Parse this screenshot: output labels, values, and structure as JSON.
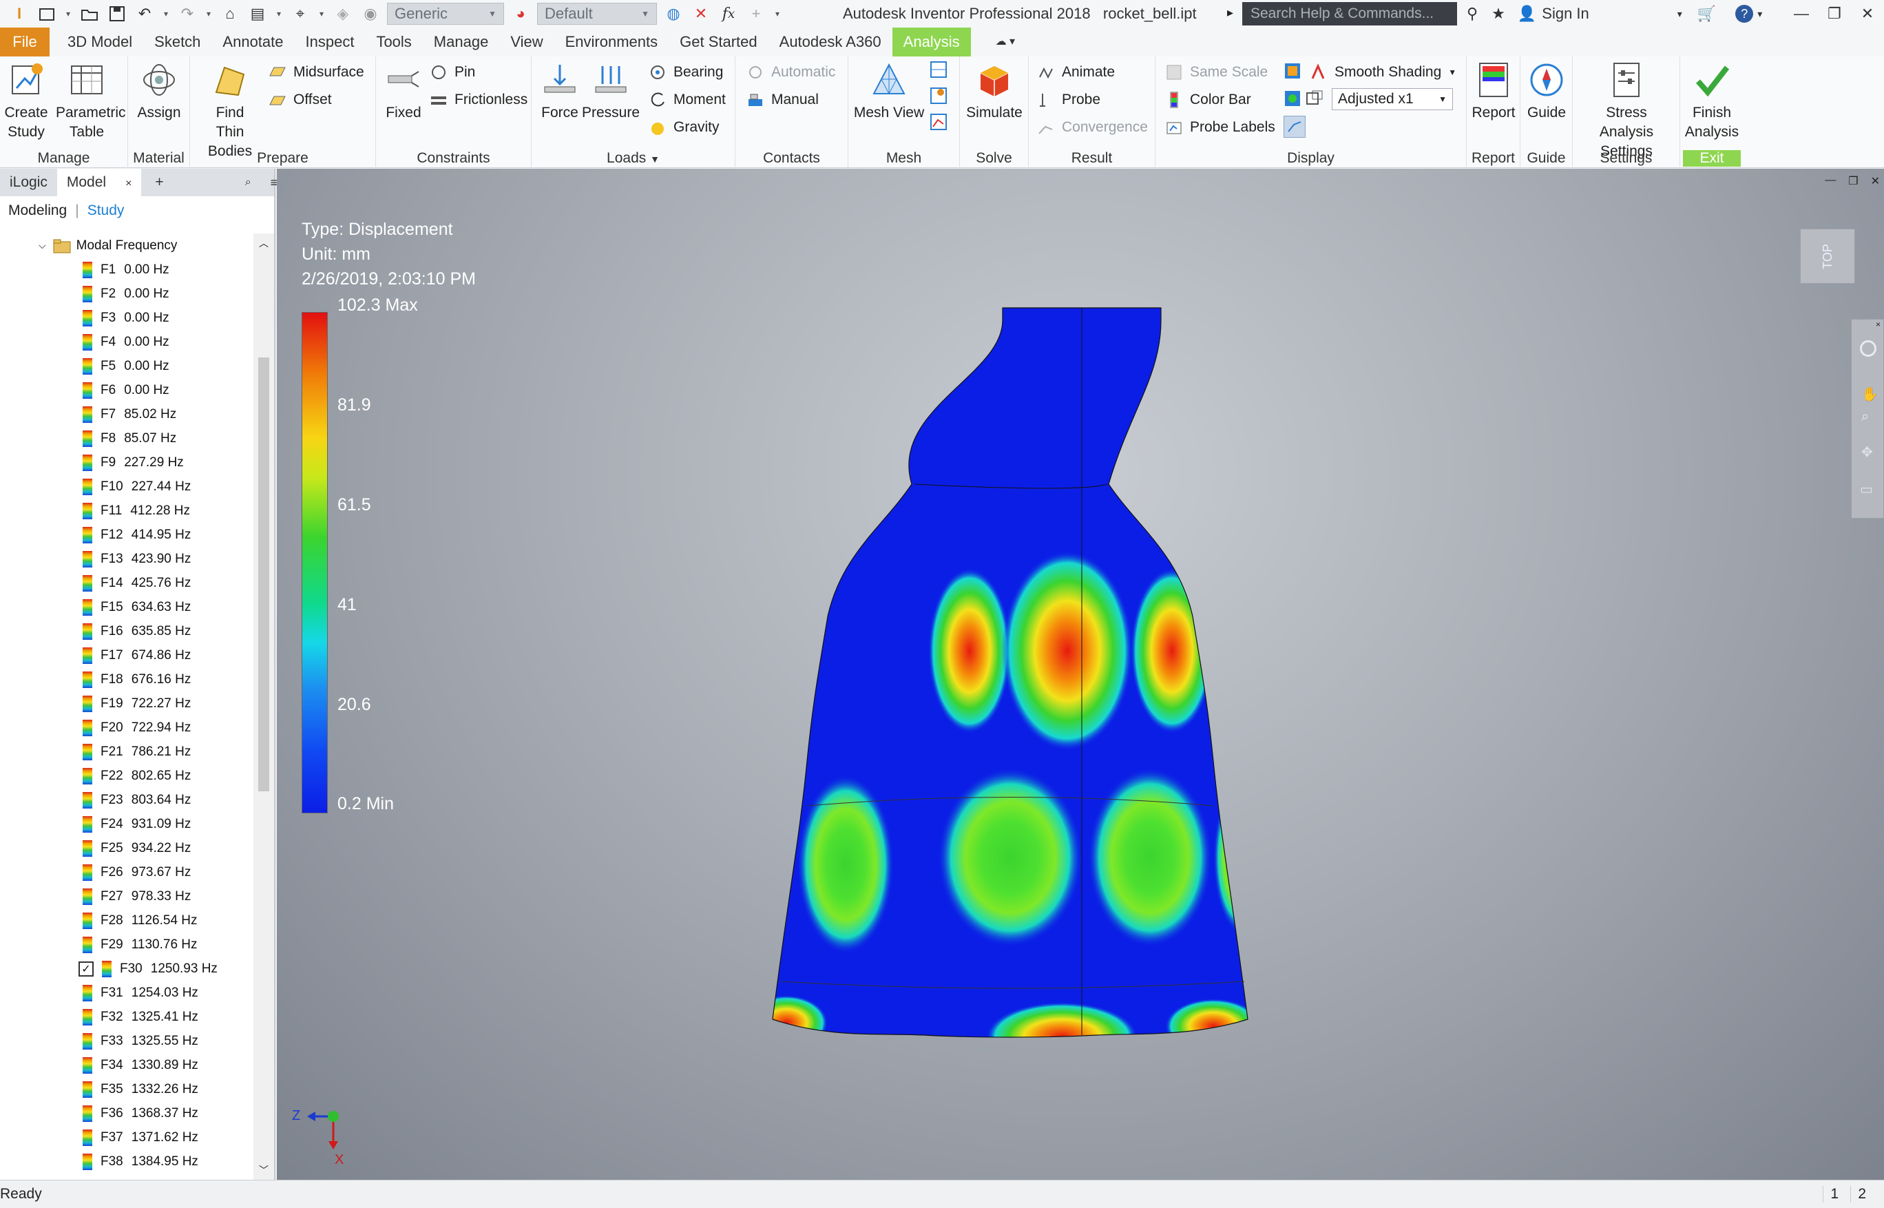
{
  "titlebar": {
    "material": "Generic",
    "appearance": "Default",
    "app_title": "Autodesk Inventor Professional 2018",
    "file_name": "rocket_bell.ipt",
    "search_placeholder": "Search Help & Commands...",
    "sign_in": "Sign In"
  },
  "tabs": [
    "File",
    "3D Model",
    "Sketch",
    "Annotate",
    "Inspect",
    "Tools",
    "Manage",
    "View",
    "Environments",
    "Get Started",
    "Autodesk A360",
    "Analysis"
  ],
  "ribbon": {
    "manage": {
      "label": "Manage",
      "create_study": "Create Study",
      "parametric_table": "Parametric Table"
    },
    "material": {
      "label": "Material",
      "assign": "Assign"
    },
    "prepare": {
      "label": "Prepare",
      "find_thin_bodies": "Find Thin Bodies",
      "midsurface": "Midsurface",
      "offset": "Offset"
    },
    "constraints": {
      "label": "Constraints",
      "fixed": "Fixed",
      "pin": "Pin",
      "frictionless": "Frictionless"
    },
    "loads": {
      "label": "Loads",
      "force": "Force",
      "pressure": "Pressure",
      "bearing": "Bearing",
      "moment": "Moment",
      "gravity": "Gravity"
    },
    "contacts": {
      "label": "Contacts",
      "automatic": "Automatic",
      "manual": "Manual"
    },
    "mesh": {
      "label": "Mesh",
      "mesh_view": "Mesh View"
    },
    "solve": {
      "label": "Solve",
      "simulate": "Simulate"
    },
    "result": {
      "label": "Result",
      "animate": "Animate",
      "probe": "Probe",
      "convergence": "Convergence"
    },
    "display": {
      "label": "Display",
      "same_scale": "Same Scale",
      "color_bar": "Color Bar",
      "probe_labels": "Probe Labels",
      "shading": "Smooth Shading",
      "adjusted": "Adjusted x1"
    },
    "report": {
      "label": "Report",
      "report": "Report"
    },
    "guide": {
      "label": "Guide",
      "guide": "Guide"
    },
    "settings": {
      "label": "Settings",
      "stress_settings": "Stress Analysis Settings"
    },
    "exit": {
      "label": "Exit",
      "finish": "Finish Analysis"
    }
  },
  "panel": {
    "tabs": [
      "iLogic",
      "Model"
    ],
    "subtabs": [
      "Modeling",
      "Study"
    ],
    "tree_root": "Modal Frequency",
    "checked_item": "F30",
    "frequencies": [
      [
        "F1",
        "0.00 Hz"
      ],
      [
        "F2",
        "0.00 Hz"
      ],
      [
        "F3",
        "0.00 Hz"
      ],
      [
        "F4",
        "0.00 Hz"
      ],
      [
        "F5",
        "0.00 Hz"
      ],
      [
        "F6",
        "0.00 Hz"
      ],
      [
        "F7",
        "85.02 Hz"
      ],
      [
        "F8",
        "85.07 Hz"
      ],
      [
        "F9",
        "227.29 Hz"
      ],
      [
        "F10",
        "227.44 Hz"
      ],
      [
        "F11",
        "412.28 Hz"
      ],
      [
        "F12",
        "414.95 Hz"
      ],
      [
        "F13",
        "423.90 Hz"
      ],
      [
        "F14",
        "425.76 Hz"
      ],
      [
        "F15",
        "634.63 Hz"
      ],
      [
        "F16",
        "635.85 Hz"
      ],
      [
        "F17",
        "674.86 Hz"
      ],
      [
        "F18",
        "676.16 Hz"
      ],
      [
        "F19",
        "722.27 Hz"
      ],
      [
        "F20",
        "722.94 Hz"
      ],
      [
        "F21",
        "786.21 Hz"
      ],
      [
        "F22",
        "802.65 Hz"
      ],
      [
        "F23",
        "803.64 Hz"
      ],
      [
        "F24",
        "931.09 Hz"
      ],
      [
        "F25",
        "934.22 Hz"
      ],
      [
        "F26",
        "973.67 Hz"
      ],
      [
        "F27",
        "978.33 Hz"
      ],
      [
        "F28",
        "1126.54 Hz"
      ],
      [
        "F29",
        "1130.76 Hz"
      ],
      [
        "F30",
        "1250.93 Hz"
      ],
      [
        "F31",
        "1254.03 Hz"
      ],
      [
        "F32",
        "1325.41 Hz"
      ],
      [
        "F33",
        "1325.55 Hz"
      ],
      [
        "F34",
        "1330.89 Hz"
      ],
      [
        "F35",
        "1332.26 Hz"
      ],
      [
        "F36",
        "1368.37 Hz"
      ],
      [
        "F37",
        "1371.62 Hz"
      ],
      [
        "F38",
        "1384.95 Hz"
      ]
    ]
  },
  "viewport": {
    "type_line": "Type: Displacement",
    "unit_line": "Unit: mm",
    "date_line": "2/26/2019, 2:03:10 PM",
    "legend": [
      "102.3 Max",
      "81.9",
      "61.5",
      "41",
      "20.6",
      "0.2 Min"
    ],
    "viewcube": "TOP",
    "axis_z": "Z",
    "axis_x": "X"
  },
  "status": {
    "text": "Ready",
    "page1": "1",
    "page2": "2"
  },
  "colors": {
    "file_tab": "#e08a1e",
    "analysis_tab": "#8ed650",
    "model_blue": "#0b1ee6"
  }
}
